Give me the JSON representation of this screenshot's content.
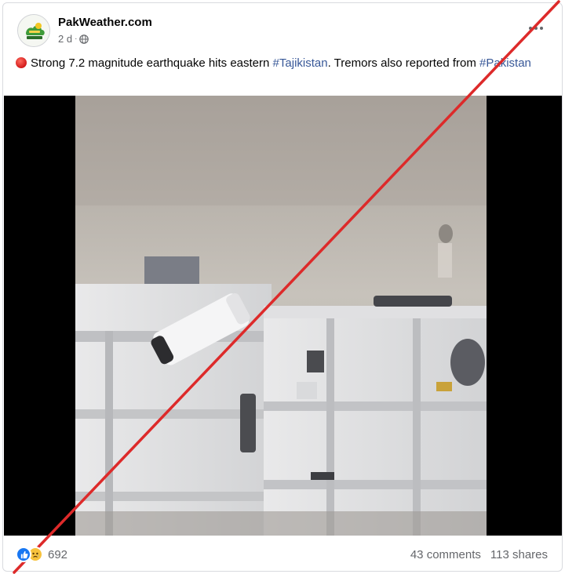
{
  "post": {
    "page_name": "PakWeather.com",
    "time": "2 d",
    "separator": "·",
    "caption_text": "Strong 7.2 magnitude earthquake hits eastern ",
    "hashtag_1": "#Tajikistan",
    "caption_text_2": ". Tremors also reported from ",
    "hashtag_2": "#Pakistan"
  },
  "engagement": {
    "reaction_count": "692",
    "comments": "43 comments",
    "shares": "113 shares"
  },
  "icons": {
    "caption_emoji": "red-circle-icon",
    "privacy": "globe-icon",
    "reactions": [
      "like-icon",
      "sad-icon"
    ],
    "overlay": "red-strike-line"
  },
  "colors": {
    "hashtag": "#385898",
    "like": "#1877f2",
    "strike": "#dd2a2a",
    "muted_text": "#65676b"
  }
}
